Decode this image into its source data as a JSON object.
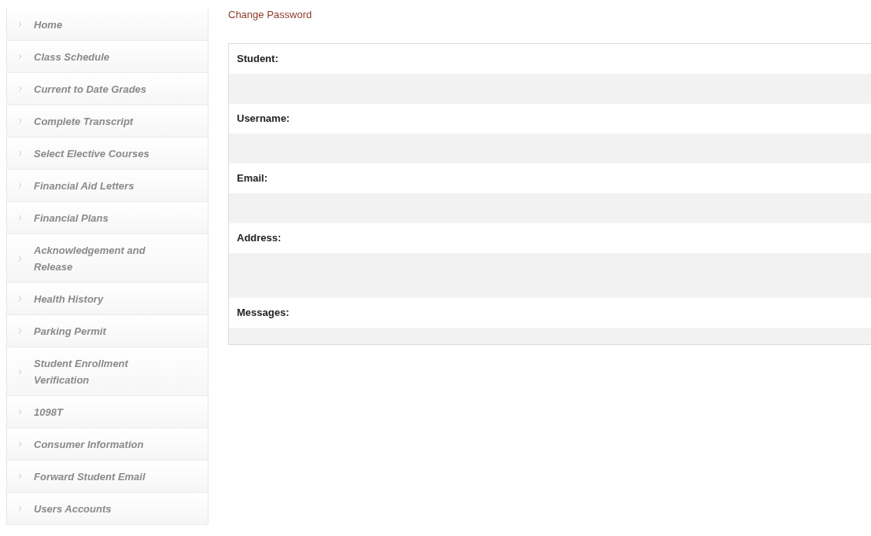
{
  "sidebar": {
    "items": [
      {
        "label": "Home"
      },
      {
        "label": "Class Schedule"
      },
      {
        "label": "Current to Date Grades"
      },
      {
        "label": "Complete Transcript"
      },
      {
        "label": "Select Elective Courses"
      },
      {
        "label": "Financial Aid Letters"
      },
      {
        "label": "Financial Plans"
      },
      {
        "label": "Acknowledgement and Release"
      },
      {
        "label": "Health History"
      },
      {
        "label": "Parking Permit"
      },
      {
        "label": "Student Enrollment Verification"
      },
      {
        "label": "1098T"
      },
      {
        "label": "Consumer Information"
      },
      {
        "label": "Forward Student Email"
      },
      {
        "label": "Users Accounts"
      }
    ]
  },
  "main": {
    "link": "Change Password",
    "fields": [
      {
        "label": "Student:",
        "kind": "line"
      },
      {
        "label": "Username:",
        "kind": "line"
      },
      {
        "label": "Email:",
        "kind": "line"
      },
      {
        "label": "Address:",
        "kind": "multiline"
      },
      {
        "label": "Messages:",
        "kind": "short"
      }
    ]
  }
}
